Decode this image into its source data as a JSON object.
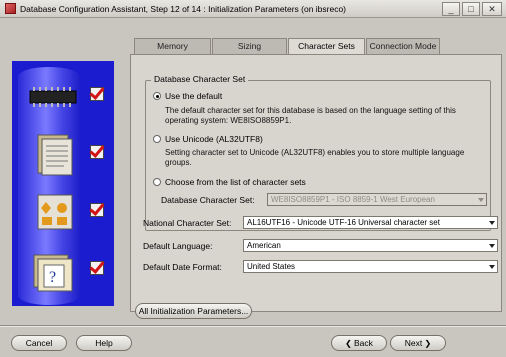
{
  "window": {
    "title": "Database Configuration Assistant, Step 12 of 14 : Initialization Parameters (on ibsreco)",
    "buttons": [
      "_",
      "□",
      "✕"
    ]
  },
  "tabs": [
    {
      "label": "Memory"
    },
    {
      "label": "Sizing"
    },
    {
      "label": "Character Sets",
      "active": true
    },
    {
      "label": "Connection Mode"
    }
  ],
  "db_charset": {
    "group_label": "Database Character Set",
    "option_default": {
      "label": "Use the default",
      "selected": true,
      "desc_line1": "The default character set for this database is based on the language setting of this",
      "desc_line2": "operating system: WE8ISO8859P1."
    },
    "option_unicode": {
      "label": "Use Unicode (AL32UTF8)",
      "desc_line1": "Setting character set to Unicode (AL32UTF8) enables you to store multiple language",
      "desc_line2": "groups."
    },
    "option_choose": {
      "label": "Choose from the list of character sets"
    },
    "charset_label": "Database Character Set:",
    "charset_value": "WE8ISO8859P1 - ISO 8859-1 West European"
  },
  "fields": {
    "national_label": "National Character Set:",
    "national_value": "AL16UTF16 - Unicode UTF-16 Universal character set",
    "language_label": "Default Language:",
    "language_value": "American",
    "date_label": "Default Date Format:",
    "date_value": "United States"
  },
  "buttons": {
    "all_params": "All Initialization Parameters...",
    "cancel": "Cancel",
    "help": "Help",
    "back": "Back",
    "next": "Next"
  }
}
